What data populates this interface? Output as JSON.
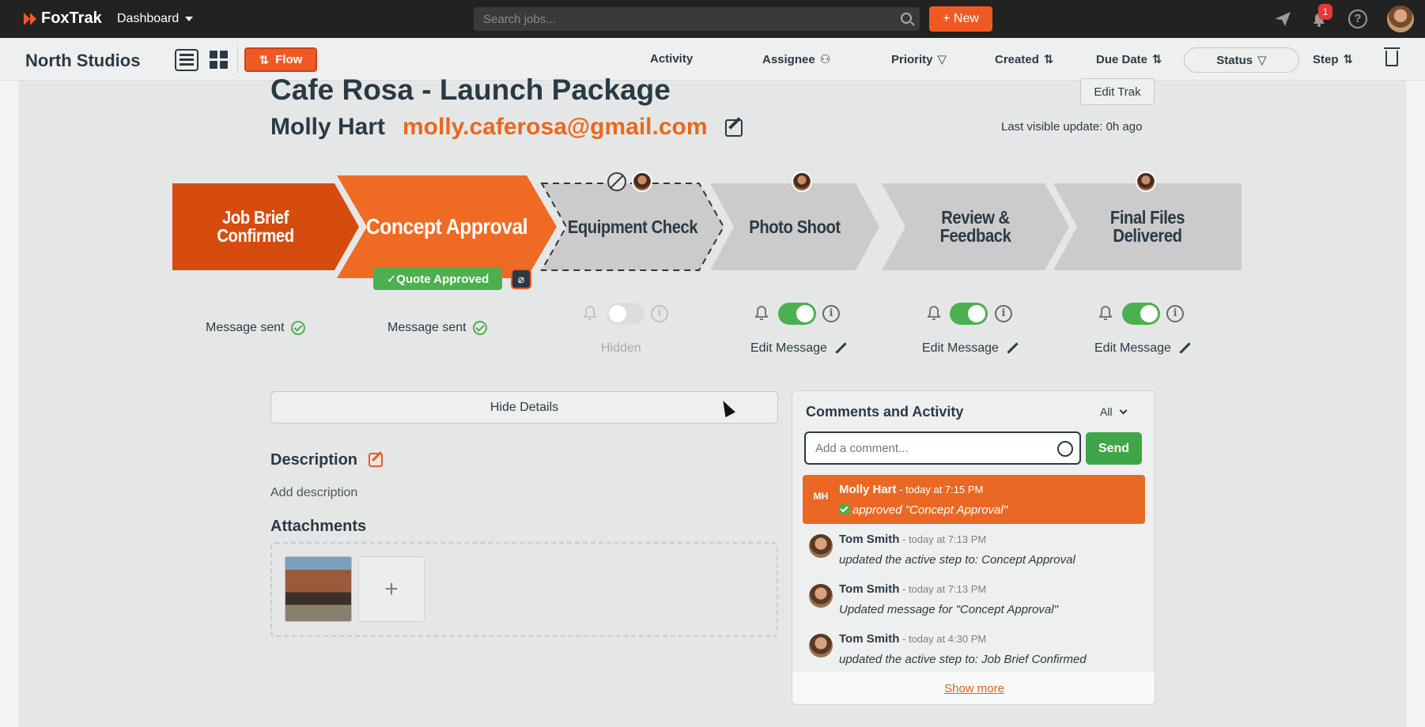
{
  "app": {
    "logo_text": "FoxTrak",
    "menu_label": "Dashboard",
    "search_placeholder": "Search jobs...",
    "new_label": "+ New",
    "notification_count": "1",
    "brand_color": "#ef5a24"
  },
  "toolbar": {
    "org_name": "North Studios",
    "flow_label": "Flow",
    "columns": [
      {
        "label": "Activity",
        "icon": "none"
      },
      {
        "label": "Assignee",
        "icon": "user-icon"
      },
      {
        "label": "Priority",
        "icon": "filter-icon"
      },
      {
        "label": "Created",
        "icon": "sort-icon"
      },
      {
        "label": "Due Date",
        "icon": "sort-icon"
      },
      {
        "label": "Status",
        "icon": "filter-icon"
      },
      {
        "label": "Step",
        "icon": "sort-icon"
      }
    ]
  },
  "job": {
    "title": "Cafe Rosa - Launch Package",
    "client_name": "Molly Hart",
    "client_email": "molly.caferosa@gmail.com",
    "edit_label": "Edit Trak",
    "last_update": "Last visible update: 0h ago"
  },
  "steps": [
    {
      "label": "Job Brief Confirmed",
      "state": "completed",
      "notify_text": "Message sent",
      "color": "#d64c0e"
    },
    {
      "label": "Concept Approval",
      "state": "active",
      "notify_text": "Message sent",
      "badge": "✓Quote Approved",
      "color": "#ef6a22"
    },
    {
      "label": "Equipment Check",
      "state": "hidden",
      "notify_text": "Hidden",
      "toggle": "off",
      "color": "#cccccc"
    },
    {
      "label": "Photo Shoot",
      "state": "upcoming",
      "notify_text": "Edit Message",
      "toggle": "on",
      "color": "#cccccc"
    },
    {
      "label": "Review & Feedback",
      "state": "upcoming",
      "notify_text": "Edit Message",
      "toggle": "on",
      "color": "#cccccc"
    },
    {
      "label": "Final Files Delivered",
      "state": "upcoming",
      "notify_text": "Edit Message",
      "toggle": "on",
      "color": "#cccccc"
    }
  ],
  "details": {
    "hide_label": "Hide Details",
    "description_heading": "Description",
    "description_placeholder": "Add description",
    "attachments_heading": "Attachments",
    "add_attachment": "+"
  },
  "comments": {
    "title": "Comments and Activity",
    "filter": "All",
    "input_placeholder": "Add a comment...",
    "send_label": "Send",
    "show_more": "Show more",
    "items": [
      {
        "author": "Molly Hart",
        "initials": "MH",
        "time": " - today at 7:15 PM",
        "text": "approved \"Concept Approval\"",
        "highlight": true
      },
      {
        "author": "Tom Smith",
        "time": " - today at 7:13 PM",
        "text": "updated the active step to: Concept Approval"
      },
      {
        "author": "Tom Smith",
        "time": " - today at 7:13 PM",
        "text": "Updated message for \"Concept Approval\""
      },
      {
        "author": "Tom Smith",
        "time": " - today at 4:30 PM",
        "text": "updated the active step to: Job Brief Confirmed"
      }
    ]
  }
}
